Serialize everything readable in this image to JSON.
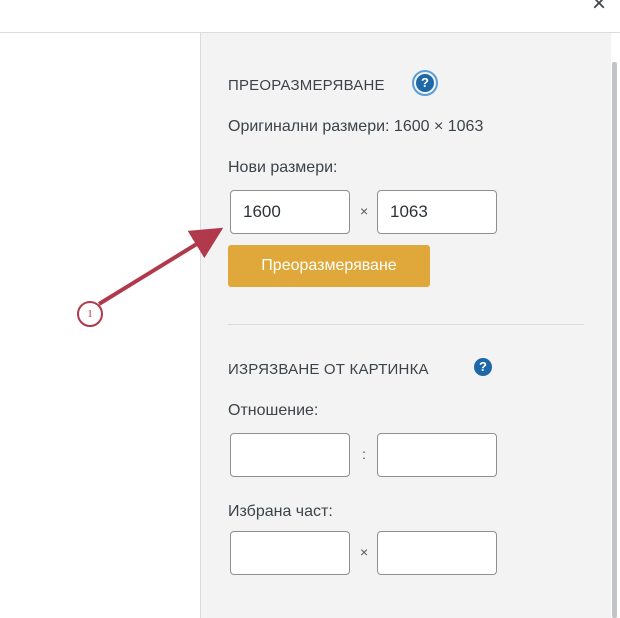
{
  "window": {
    "close_glyph": "×"
  },
  "resize": {
    "title": "ПРЕОРАЗМЕРЯВАНЕ",
    "original_label": "Оригинални размери: 1600 × 1063",
    "new_label": "Нови размери:",
    "width_value": "1600",
    "height_value": "1063",
    "times_glyph": "×",
    "button_label": "Преоразмеряване"
  },
  "crop": {
    "title": "ИЗРЯЗВАНЕ ОТ КАРТИНКА",
    "ratio_label": "Отношение:",
    "ratio_sep": ":",
    "selection_label": "Избрана част:",
    "times_glyph": "×"
  },
  "help_glyph": "?",
  "annotation": {
    "number": "1",
    "color": "#b03a4c"
  },
  "colors": {
    "accent_button": "#e0a83a",
    "help_icon": "#1e68a8"
  }
}
